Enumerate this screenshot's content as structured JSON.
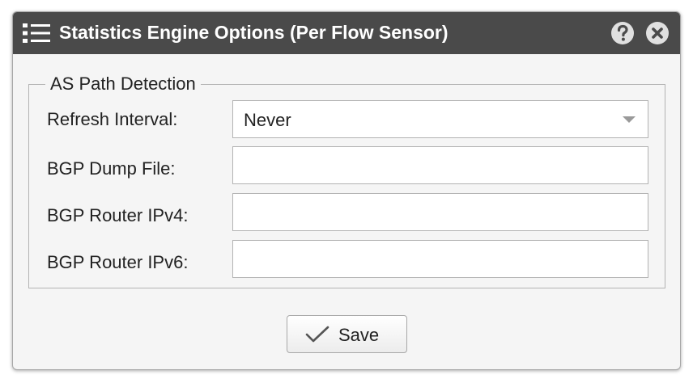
{
  "dialog": {
    "title": "Statistics Engine Options (Per Flow Sensor)",
    "icons": {
      "menu": "list-menu-icon",
      "help": "question-icon",
      "close": "close-icon"
    }
  },
  "fieldset": {
    "legend": "AS Path Detection",
    "fields": [
      {
        "label": "Refresh Interval:",
        "type": "select",
        "value": "Never"
      },
      {
        "label": "BGP Dump File:",
        "type": "text",
        "value": ""
      },
      {
        "label": "BGP Router IPv4:",
        "type": "text",
        "value": ""
      },
      {
        "label": "BGP Router IPv6:",
        "type": "text",
        "value": ""
      }
    ]
  },
  "footer": {
    "save_label": "Save",
    "save_icon": "checkmark-icon"
  },
  "colors": {
    "titlebar": "#4a4a4a",
    "dialog_bg": "#f5f5f5",
    "border": "#b3b3b3",
    "text": "#222222"
  }
}
